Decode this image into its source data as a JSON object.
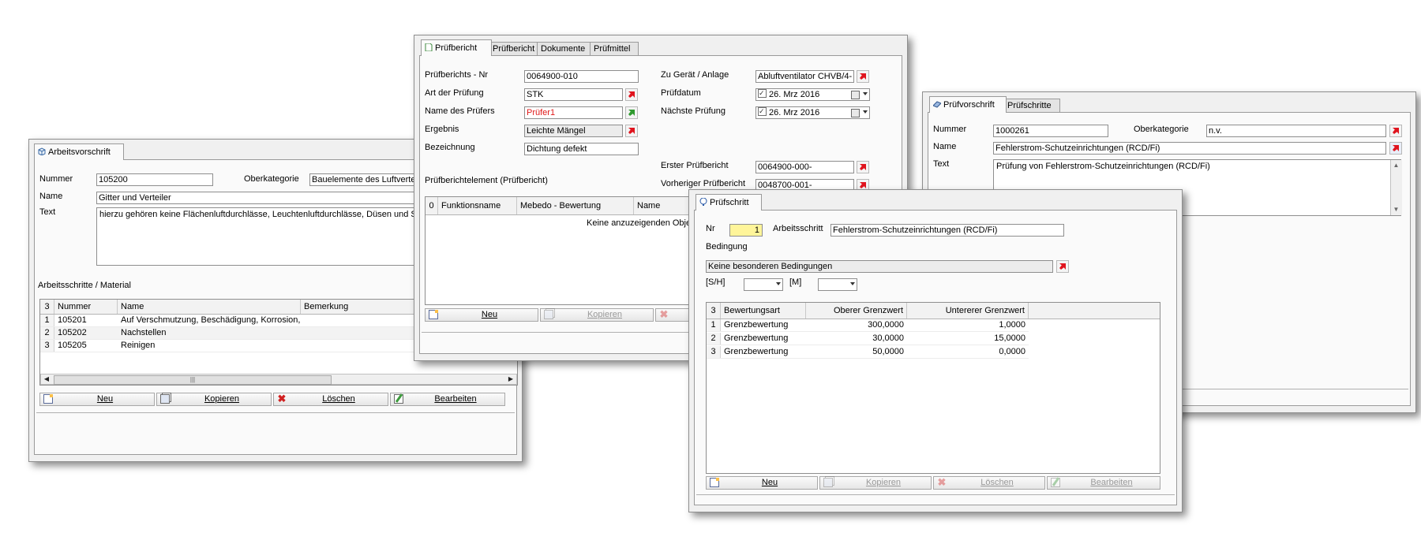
{
  "win1": {
    "tab": "Arbeitsvorschrift",
    "nummer_label": "Nummer",
    "nummer": "105200",
    "oberkategorie_label": "Oberkategorie",
    "oberkategorie": "Bauelemente des Luftverteil",
    "name_label": "Name",
    "name": "Gitter und Verteiler",
    "text_label": "Text",
    "text": "hierzu gehören keine Flächenluftdurchlässe, Leuchtenluftdurchlässe, Düsen und Sc",
    "section": "Arbeitsschritte / Material",
    "grid": {
      "count": "3",
      "headers": [
        "Nummer",
        "Name",
        "Bemerkung"
      ],
      "rows": [
        {
          "idx": "1",
          "nummer": "105201",
          "name": "Auf Verschmutzung, Beschädigung, Korrosion, Befe...",
          "bemerkung": ""
        },
        {
          "idx": "2",
          "nummer": "105202",
          "name": "Nachstellen",
          "bemerkung": ""
        },
        {
          "idx": "3",
          "nummer": "105205",
          "name": "Reinigen",
          "bemerkung": ""
        }
      ]
    },
    "buttons": {
      "neu": "Neu",
      "kopieren": "Kopieren",
      "loeschen": "Löschen",
      "bearbeiten": "Bearbeiten"
    }
  },
  "win2": {
    "tabs": [
      "Prüfbericht",
      "Prüfbericht",
      "Dokumente",
      "Prüfmittel"
    ],
    "left": {
      "nr_label": "Prüfberichts - Nr",
      "nr": "0064900-010",
      "art_label": "Art der Prüfung",
      "art": "STK",
      "pruefer_label": "Name des Prüfers",
      "pruefer": "Prüfer1",
      "ergebnis_label": "Ergebnis",
      "ergebnis": "Leichte Mängel",
      "bezeichnung_label": "Bezeichnung",
      "bezeichnung": "Dichtung defekt"
    },
    "right": {
      "geraet_label": "Zu Gerät / Anlage",
      "geraet": "Abluftventilator CHVB/4-",
      "pruefdatum_label": "Prüfdatum",
      "pruefdatum": "26. Mrz 2016",
      "naechste_label": "Nächste Prüfung",
      "naechste": "26. Mrz 2016",
      "erster_label": "Erster Prüfbericht",
      "erster": "0064900-000-",
      "vorheriger_label": "Vorheriger Prüfbericht",
      "vorheriger": "0048700-001-"
    },
    "section": "Prüfberichtelement (Prüfbericht)",
    "grid": {
      "count": "0",
      "headers": [
        "Funktionsname",
        "Mebedo - Bewertung",
        "Name"
      ],
      "empty": "Keine anzuzeigenden Objekt"
    },
    "buttons": {
      "neu": "Neu",
      "kopieren": "Kopieren"
    }
  },
  "win3": {
    "tabs": [
      "Prüfvorschrift",
      "Prüfschritte"
    ],
    "nummer_label": "Nummer",
    "nummer": "1000261",
    "oberkategorie_label": "Oberkategorie",
    "oberkategorie": "n.v.",
    "name_label": "Name",
    "name": "Fehlerstrom-Schutzeinrichtungen (RCD/Fi)",
    "text_label": "Text",
    "text": "Prüfung von Fehlerstrom-Schutzeinrichtungen (RCD/Fi)"
  },
  "win4": {
    "tab": "Prüfschritt",
    "nr_label": "Nr",
    "nr": "1",
    "arbeitsschritt_label": "Arbeitsschritt",
    "arbeitsschritt": "Fehlerstrom-Schutzeinrichtungen (RCD/Fi)",
    "bedingung_label": "Bedingung",
    "bedingung": "Keine besonderen Bedingungen",
    "sh_label": "[S/H]",
    "m_label": "[M]",
    "grid": {
      "count": "3",
      "headers": [
        "Bewertungsart",
        "Oberer Grenzwert",
        "Untererer Grenzwert"
      ],
      "rows": [
        {
          "idx": "1",
          "art": "Grenzbewertung",
          "oben": "300,0000",
          "unten": "1,0000"
        },
        {
          "idx": "2",
          "art": "Grenzbewertung",
          "oben": "30,0000",
          "unten": "15,0000"
        },
        {
          "idx": "3",
          "art": "Grenzbewertung",
          "oben": "50,0000",
          "unten": "0,0000"
        }
      ]
    },
    "buttons": {
      "neu": "Neu",
      "kopieren": "Kopieren",
      "loeschen": "Löschen",
      "bearbeiten": "Bearbeiten"
    }
  }
}
